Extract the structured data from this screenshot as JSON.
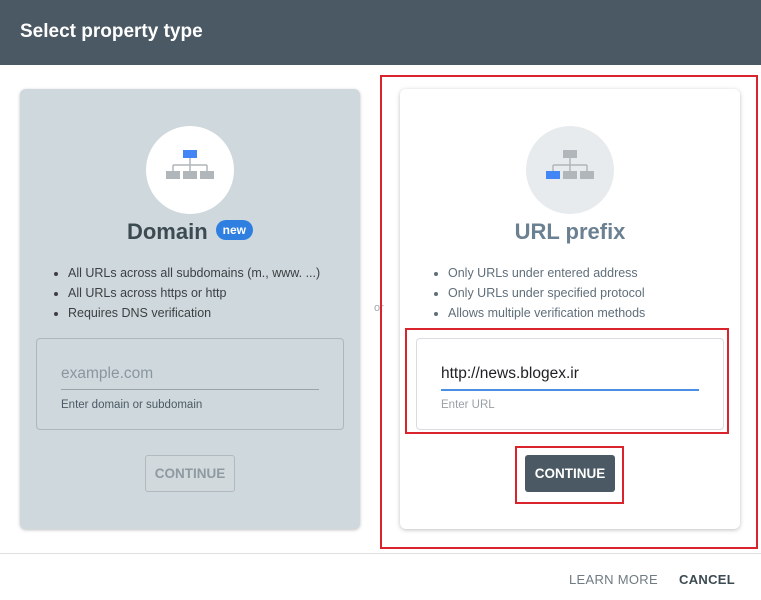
{
  "dialog": {
    "title": "Select property type"
  },
  "domain_card": {
    "title": "Domain",
    "badge": "new",
    "features": [
      "All URLs across all subdomains (m., www. ...)",
      "All URLs across https or http",
      "Requires DNS verification"
    ],
    "input": {
      "placeholder": "example.com",
      "help": "Enter domain or subdomain"
    },
    "button": "CONTINUE"
  },
  "separator": "or",
  "url_card": {
    "title": "URL prefix",
    "features": [
      "Only URLs under entered address",
      "Only URLs under specified protocol",
      "Allows multiple verification methods"
    ],
    "input": {
      "value": "http://news.blogex.ir",
      "help": "Enter URL"
    },
    "button": "CONTINUE"
  },
  "footer": {
    "learn_more": "LEARN MORE",
    "cancel": "CANCEL"
  },
  "colors": {
    "header_bg": "#4a5963",
    "accent_blue": "#2f7fe0",
    "highlight_red": "#d9232d"
  }
}
